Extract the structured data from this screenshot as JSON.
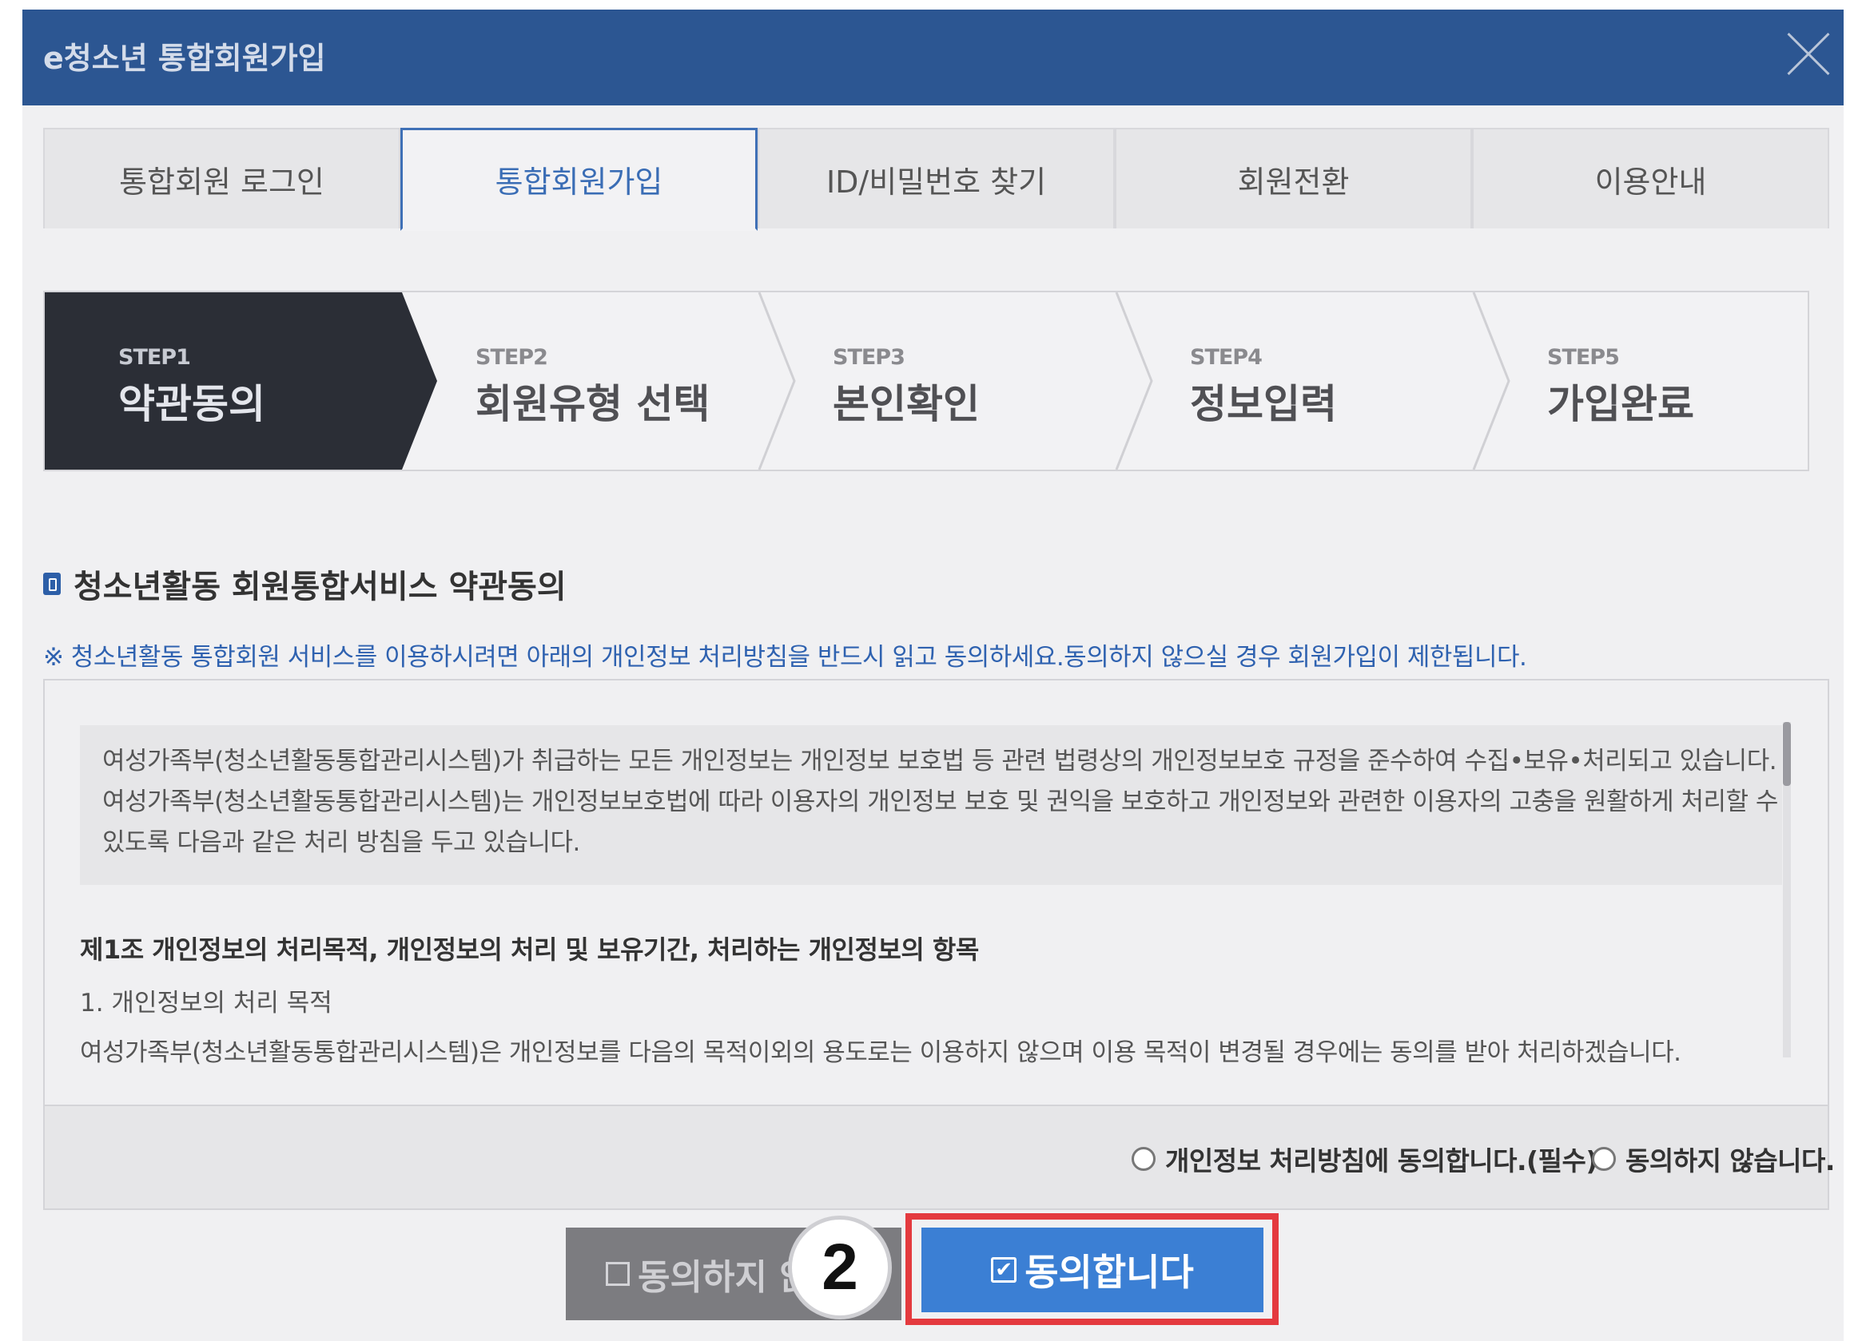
{
  "dialog": {
    "title": "e청소년 통합회원가입"
  },
  "tabs": [
    {
      "label": "통합회원 로그인",
      "active": false
    },
    {
      "label": "통합회원가입",
      "active": true
    },
    {
      "label": "ID/비밀번호 찾기",
      "active": false
    },
    {
      "label": "회원전환",
      "active": false
    },
    {
      "label": "이용안내",
      "active": false
    }
  ],
  "steps": [
    {
      "step": "STEP1",
      "label": "약관동의",
      "active": true
    },
    {
      "step": "STEP2",
      "label": "회원유형 선택",
      "active": false
    },
    {
      "step": "STEP3",
      "label": "본인확인",
      "active": false
    },
    {
      "step": "STEP4",
      "label": "정보입력",
      "active": false
    },
    {
      "step": "STEP5",
      "label": "가입완료",
      "active": false
    }
  ],
  "section": {
    "title": "청소년활동 회원통합서비스 약관동의",
    "notice": "※ 청소년활동 통합회원 서비스를 이용하시려면 아래의 개인정보 처리방침을 반드시 읽고 동의하세요.동의하지 않으실 경우 회원가입이 제한됩니다."
  },
  "terms": {
    "intro_lines": [
      "여성가족부(청소년활동통합관리시스템)가 취급하는 모든 개인정보는 개인정보 보호법 등 관련 법령상의 개인정보보호 규정을 준수하여 수집•보유•처리되고 있습니다.",
      "여성가족부(청소년활동통합관리시스템)는 개인정보보호법에 따라 이용자의 개인정보 보호 및 권익을 보호하고 개인정보와 관련한 이용자의 고충을 원활하게 처리할 수",
      "있도록 다음과 같은 처리 방침을 두고 있습니다."
    ],
    "article_title": "제1조 개인정보의 처리목적, 개인정보의 처리 및 보유기간, 처리하는 개인정보의 항목",
    "item": "1. 개인정보의 처리 목적",
    "body": "여성가족부(청소년활동통합관리시스템)은 개인정보를 다음의 목적이외의 용도로는 이용하지 않으며 이용 목적이 변경될 경우에는 동의를 받아 처리하겠습니다."
  },
  "consent": {
    "agree_label": "개인정보 처리방침에 동의합니다.(필수)",
    "disagree_label": "동의하지 않습니다."
  },
  "buttons": {
    "decline_label": "동의하지 않",
    "agree_label": "동의합니다"
  },
  "badge": {
    "number": "2"
  },
  "colors": {
    "titlebar": "#2c5692",
    "accent": "#3b7fd4",
    "highlight": "#e43a3f"
  }
}
